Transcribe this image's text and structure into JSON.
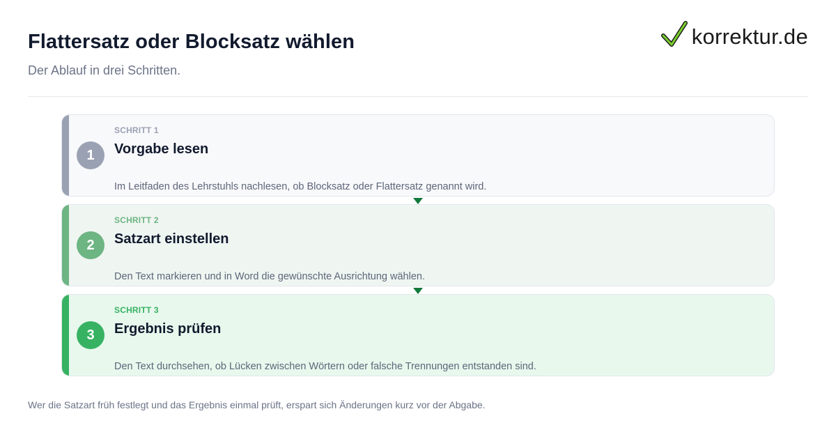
{
  "header": {
    "title": "Flattersatz oder Blocksatz wählen",
    "subtitle": "Der Ablauf in drei Schritten."
  },
  "logo": {
    "text": "korrektur.de",
    "icon": "checkmark-icon"
  },
  "steps": [
    {
      "number": "1",
      "label": "SCHRITT 1",
      "title": "Vorgabe lesen",
      "description": "Im Leitfaden des Lehrstuhls nachlesen, ob Blocksatz oder Flattersatz genannt wird.",
      "color": "#9aa1b2"
    },
    {
      "number": "2",
      "label": "SCHRITT 2",
      "title": "Satzart einstellen",
      "description": "Den Text markieren und in Word die gewünschte Ausrichtung wählen.",
      "color": "#6db583"
    },
    {
      "number": "3",
      "label": "SCHRITT 3",
      "title": "Ergebnis prüfen",
      "description": "Den Text durchsehen, ob Lücken zwischen Wörtern oder falsche Trennungen entstanden sind.",
      "color": "#36b262"
    }
  ],
  "footer": {
    "note": "Wer die Satzart früh festlegt und das Ergebnis einmal prüft, erspart sich Änderungen kurz vor der Abgabe."
  },
  "colors": {
    "arrow": "#127a3c",
    "title": "#121a2e"
  }
}
